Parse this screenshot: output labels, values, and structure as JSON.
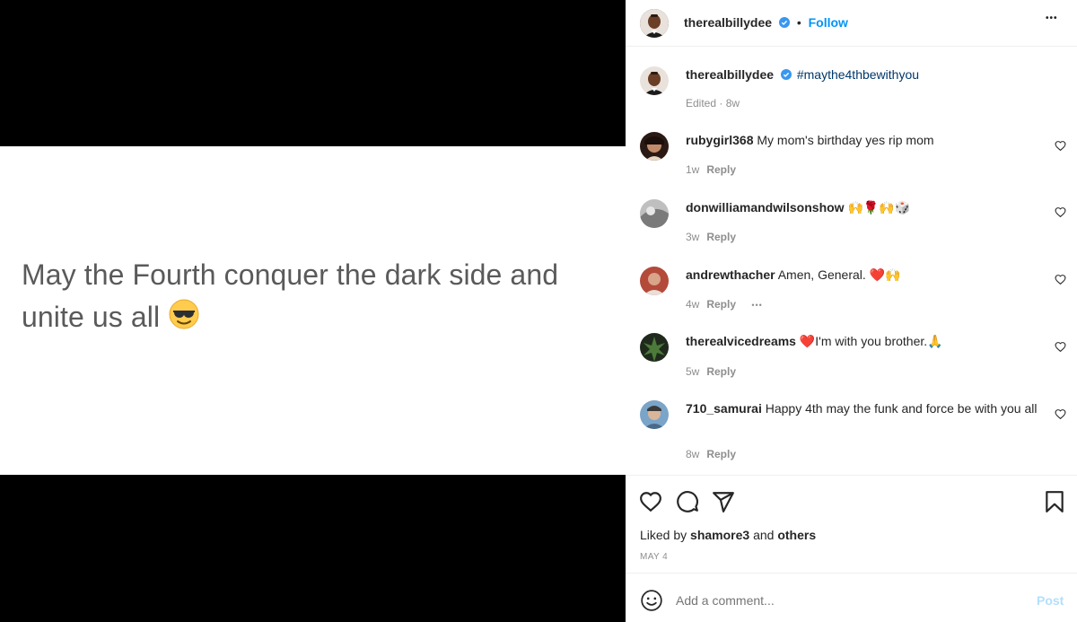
{
  "post": {
    "text": "May the Fourth conquer the dark side and unite us all",
    "emoji": "sunglasses-emoji"
  },
  "header": {
    "username": "therealbillydee",
    "dot": "•",
    "follow": "Follow",
    "more": "•••"
  },
  "caption": {
    "username": "therealbillydee",
    "hashtag": "#maythe4thbewithyou",
    "meta": "Edited · 8w"
  },
  "comments": [
    {
      "username": "rubygirl368",
      "text": "My mom's birthday yes rip mom",
      "time": "1w",
      "reply": "Reply"
    },
    {
      "username": "donwilliamandwilsonshow",
      "text": "🙌🌹🙌🎲",
      "time": "3w",
      "reply": "Reply"
    },
    {
      "username": "andrewthacher",
      "text": "Amen, General. ❤️🙌",
      "time": "4w",
      "reply": "Reply",
      "more": "•••"
    },
    {
      "username": "therealvicedreams",
      "text": "❤️I'm with you brother.🙏",
      "time": "5w",
      "reply": "Reply"
    },
    {
      "username": "710_samurai",
      "text": "Happy 4th may the funk and force be with you all",
      "time": "8w",
      "reply": "Reply"
    }
  ],
  "likes": {
    "prefix": "Liked by",
    "user": "shamore3",
    "and": "and",
    "others": "others"
  },
  "date": "MAY 4",
  "comment_box": {
    "placeholder": "Add a comment...",
    "post": "Post"
  },
  "colors": {
    "link_blue": "#0095f6",
    "hashtag": "#00376b",
    "muted": "#8e8e8e",
    "verified": "#3897f0"
  }
}
